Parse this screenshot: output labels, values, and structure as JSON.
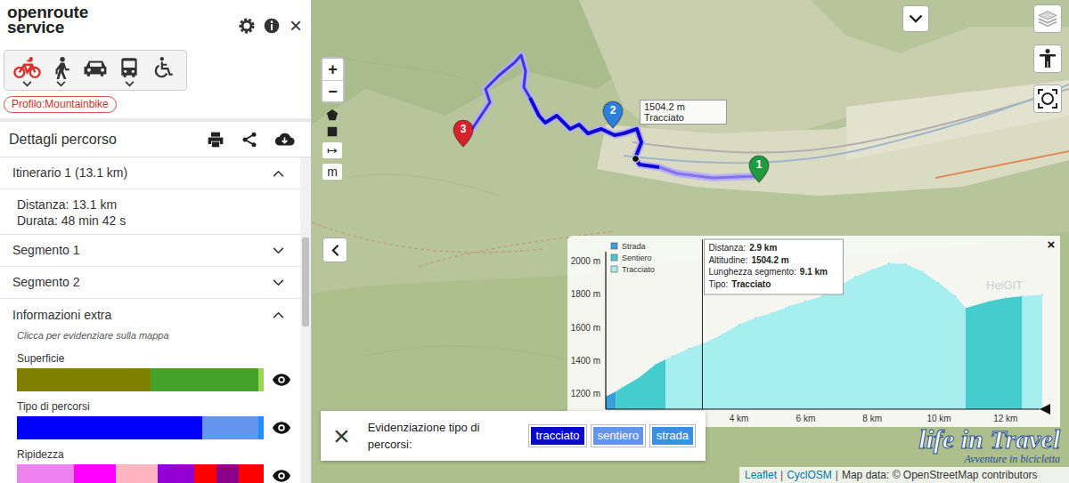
{
  "app": {
    "logo": [
      "openroute",
      "service"
    ],
    "close": "×"
  },
  "profiles": [
    {
      "kind": "bike",
      "selected": true,
      "has_menu": true
    },
    {
      "kind": "walk",
      "selected": false,
      "has_menu": true
    },
    {
      "kind": "car",
      "selected": false,
      "has_menu": false
    },
    {
      "kind": "bus",
      "selected": false,
      "has_menu": true
    },
    {
      "kind": "wheelchair",
      "selected": false,
      "has_menu": false
    }
  ],
  "profile_badge": "Profilo:Mountainbike",
  "details": {
    "title": "Dettagli percorso"
  },
  "route": {
    "title": "Itinerario 1 (13.1 km)",
    "expanded": true,
    "stats": [
      {
        "label": "Distanza:",
        "value": "13.1 km"
      },
      {
        "label": "Durata:",
        "value": "48 min 42 s"
      }
    ]
  },
  "segments": [
    {
      "label": "Segmento 1",
      "expanded": false
    },
    {
      "label": "Segmento 2",
      "expanded": false
    }
  ],
  "extra": {
    "title": "Informazioni extra",
    "expanded": true,
    "hint": "Clicca per evidenziare sulla mappa",
    "bars": [
      {
        "title": "Superficie",
        "visible": true,
        "parts": [
          {
            "level": 0.54,
            "color": "#7f8000"
          },
          {
            "level": 0.44,
            "color": "#45a12c"
          },
          {
            "level": 0.02,
            "color": "#9ad84e"
          }
        ]
      },
      {
        "title": "Tipo di percorsi",
        "visible": true,
        "parts": [
          {
            "level": 0.75,
            "color": "#0000ff"
          },
          {
            "level": 0.23,
            "color": "#6495ed"
          },
          {
            "level": 0.02,
            "color": "#1e90ff"
          }
        ]
      },
      {
        "title": "Ripidezza",
        "visible": true,
        "parts": [
          {
            "level": 0.23,
            "color": "#ee82ee"
          },
          {
            "level": 0.17,
            "color": "#ff00ff"
          },
          {
            "level": 0.17,
            "color": "#ffb6c1"
          },
          {
            "level": 0.15,
            "color": "#9400d3"
          },
          {
            "level": 0.09,
            "color": "#ff0000"
          },
          {
            "level": 0.09,
            "color": "#8b008b"
          },
          {
            "level": 0.1,
            "color": "#ff0000"
          }
        ]
      }
    ]
  },
  "map": {
    "markers": [
      {
        "label": "1",
        "color": "#1f9a3c"
      },
      {
        "label": "2",
        "color": "#2f7fd8"
      },
      {
        "label": "3",
        "color": "#d9232b"
      }
    ],
    "route_tooltip": [
      "1504.2 m",
      "Tracciato"
    ],
    "controls": {
      "zoom_in": "+",
      "zoom_out": "−",
      "measure": "↦",
      "unit": "m"
    }
  },
  "elevation": {
    "legend": [
      {
        "label": "Strada",
        "color": "#3a9fd8"
      },
      {
        "label": "Sentiero",
        "color": "#45cccc"
      },
      {
        "label": "Tracciato",
        "color": "#a6eef0"
      }
    ],
    "y_ticks": [
      {
        "label": "2000 m",
        "value": 2000
      },
      {
        "label": "1800 m",
        "value": 1800
      },
      {
        "label": "1600 m",
        "value": 1600
      },
      {
        "label": "1400 m",
        "value": 1400
      },
      {
        "label": "1200 m",
        "value": 1200
      }
    ],
    "x_ticks": [
      {
        "label": "4 km",
        "value": 4
      },
      {
        "label": "6 km",
        "value": 6
      },
      {
        "label": "8 km",
        "value": 8
      },
      {
        "label": "10 km",
        "value": 10
      },
      {
        "label": "12 km",
        "value": 12
      }
    ],
    "distance_km": [
      0,
      0.3,
      0.5,
      1,
      1.5,
      2,
      2.5,
      2.9,
      3.5,
      4,
      4.5,
      5,
      5.5,
      6,
      6.5,
      7,
      7.5,
      8,
      8.5,
      9,
      9.5,
      10,
      10.5,
      10.8,
      11,
      11.5,
      12,
      12.5,
      13.1
    ],
    "altitude_m": [
      1185,
      1215,
      1240,
      1300,
      1380,
      1430,
      1475,
      1504,
      1560,
      1620,
      1660,
      1690,
      1730,
      1760,
      1790,
      1850,
      1910,
      1950,
      1990,
      1985,
      1940,
      1870,
      1790,
      1720,
      1730,
      1760,
      1780,
      1790,
      1800
    ],
    "sections": [
      {
        "type": "Strada",
        "from_km": 0,
        "to_km": 0.3
      },
      {
        "type": "Sentiero",
        "from_km": 0.3,
        "to_km": 1.8
      },
      {
        "type": "Tracciato",
        "from_km": 1.8,
        "to_km": 10.8
      },
      {
        "type": "Sentiero",
        "from_km": 10.8,
        "to_km": 12.5
      },
      {
        "type": "Tracciato",
        "from_km": 12.5,
        "to_km": 13.1
      }
    ],
    "cursor_km": 2.9,
    "tooltip": [
      {
        "label": "Distanza:",
        "value": "2.9 km"
      },
      {
        "label": "Altitudine:",
        "value": "1504.2 m"
      },
      {
        "label": "Lunghezza segmento:",
        "value": "9.1 km"
      },
      {
        "label": "Tipo:",
        "value": "Tracciato"
      }
    ],
    "close": "×",
    "brand": "HeiGIT"
  },
  "highlight_bar": {
    "close": "×",
    "label": "Evidenziazione tipo di percorsi:",
    "chips": [
      {
        "label": "tracciato",
        "color": "#0a0acc"
      },
      {
        "label": "sentiero",
        "color": "#6495ed"
      },
      {
        "label": "strada",
        "color": "#3a8fe0"
      }
    ]
  },
  "attribution": {
    "items": [
      "Leaflet",
      "CyclOSM",
      "Map data: © OpenStreetMap contributors"
    ],
    "separator": "|"
  },
  "watermark": {
    "title": "life in Travel",
    "subtitle": "Avventure in bicicletta"
  }
}
